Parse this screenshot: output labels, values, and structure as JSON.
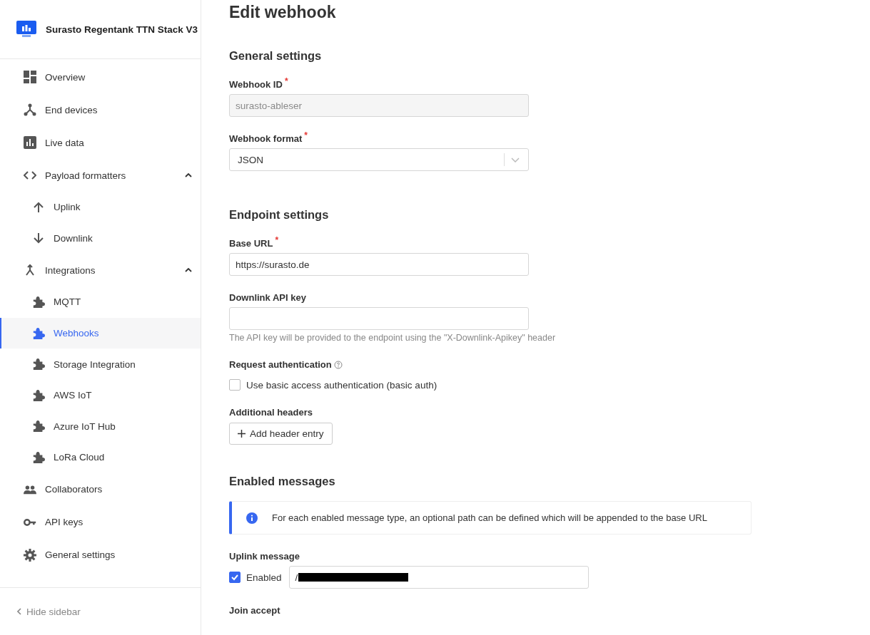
{
  "app": {
    "name": "Surasto Regentank TTN Stack V3"
  },
  "sidebar": {
    "items": [
      {
        "label": "Overview",
        "selected": false
      },
      {
        "label": "End devices",
        "selected": false
      },
      {
        "label": "Live data",
        "selected": false
      },
      {
        "label": "Payload formatters",
        "selected": false,
        "expanded": true,
        "children": [
          {
            "label": "Uplink",
            "selected": false
          },
          {
            "label": "Downlink",
            "selected": false
          }
        ]
      },
      {
        "label": "Integrations",
        "selected": false,
        "expanded": true,
        "children": [
          {
            "label": "MQTT",
            "selected": false
          },
          {
            "label": "Webhooks",
            "selected": true
          },
          {
            "label": "Storage Integration",
            "selected": false
          },
          {
            "label": "AWS IoT",
            "selected": false
          },
          {
            "label": "Azure IoT Hub",
            "selected": false
          },
          {
            "label": "LoRa Cloud",
            "selected": false
          }
        ]
      },
      {
        "label": "Collaborators",
        "selected": false
      },
      {
        "label": "API keys",
        "selected": false
      },
      {
        "label": "General settings",
        "selected": false
      }
    ],
    "footer": "Hide sidebar"
  },
  "page": {
    "title": "Edit webhook"
  },
  "general": {
    "heading": "General settings",
    "webhook_id": {
      "label": "Webhook ID",
      "required_mark": "*",
      "value": "surasto-ableser",
      "disabled": true
    },
    "webhook_format": {
      "label": "Webhook format",
      "required_mark": "*",
      "value": "JSON"
    }
  },
  "endpoint": {
    "heading": "Endpoint settings",
    "base_url": {
      "label": "Base URL",
      "required_mark": "*",
      "value": "https://surasto.de"
    },
    "downlink_api_key": {
      "label": "Downlink API key",
      "hint": "The API key will be provided to the endpoint using the \"X-Downlink-Apikey\" header"
    },
    "request_auth": {
      "label": "Request authentication",
      "checkbox": {
        "label": "Use basic access authentication (basic auth)",
        "checked": false
      }
    },
    "additional_headers": {
      "label": "Additional headers",
      "button": "Add header entry"
    }
  },
  "messages": {
    "heading": "Enabled messages",
    "info": "For each enabled message type, an optional path can be defined which will be appended to the base URL",
    "uplink": {
      "label": "Uplink message",
      "checkbox": {
        "label": "Enabled",
        "checked": true
      },
      "value": "/"
    },
    "join_accept": {
      "label": "Join accept"
    }
  }
}
